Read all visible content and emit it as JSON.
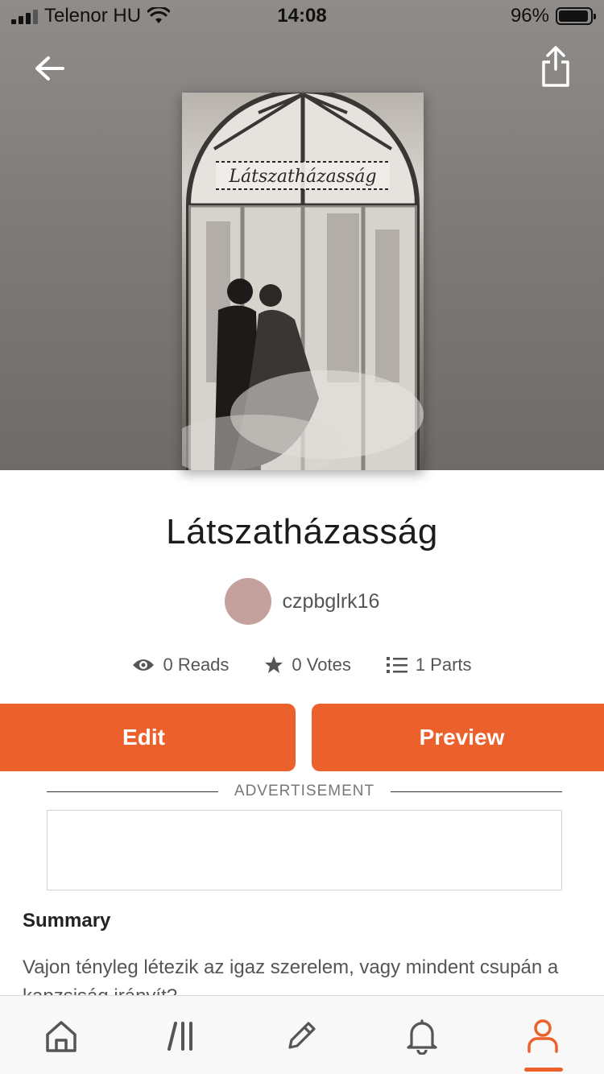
{
  "status_bar": {
    "carrier": "Telenor HU",
    "time": "14:08",
    "battery": "96%"
  },
  "header": {
    "back_icon": "arrow-left-icon",
    "share_icon": "share-icon"
  },
  "cover": {
    "title_text": "Látszatházasság"
  },
  "book": {
    "title": "Látszatházasság",
    "author": "czpbglrk16",
    "avatar_color": "#c4a19c"
  },
  "stats": {
    "reads": "0 Reads",
    "votes": "0 Votes",
    "parts": "1 Parts"
  },
  "actions": {
    "edit_label": "Edit",
    "preview_label": "Preview",
    "accent_color": "#ec612b"
  },
  "ad": {
    "label": "ADVERTISEMENT"
  },
  "summary": {
    "heading": "Summary",
    "text": "Vajon tényleg létezik az igaz szerelem, vagy mindent csupán a kapzsiság irányít?"
  },
  "tabbar": {
    "items": [
      {
        "name": "home",
        "icon": "home-icon"
      },
      {
        "name": "library",
        "icon": "library-icon"
      },
      {
        "name": "write",
        "icon": "pencil-icon"
      },
      {
        "name": "notifications",
        "icon": "bell-icon"
      },
      {
        "name": "profile",
        "icon": "profile-icon",
        "active": true
      }
    ]
  }
}
